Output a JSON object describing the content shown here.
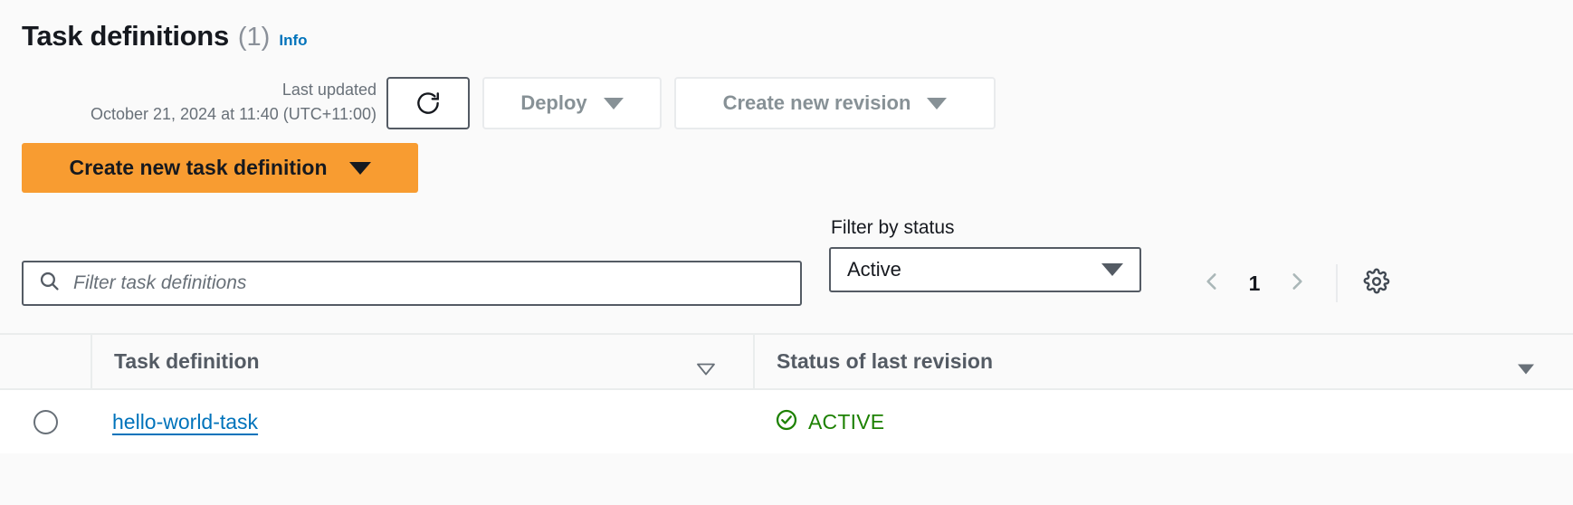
{
  "header": {
    "title": "Task definitions",
    "count": "(1)",
    "info_label": "Info"
  },
  "actions": {
    "last_updated_label": "Last updated",
    "last_updated_value": "October 21, 2024 at 11:40 (UTC+11:00)",
    "refresh_icon": "refresh-icon",
    "deploy_label": "Deploy",
    "create_revision_label": "Create new revision",
    "create_task_definition_label": "Create new task definition"
  },
  "filters": {
    "search_placeholder": "Filter task definitions",
    "search_value": "",
    "search_icon": "search-icon",
    "status_label": "Filter by status",
    "status_value": "Active",
    "status_options": [
      "Active"
    ]
  },
  "pagination": {
    "prev_icon": "chevron-left-icon",
    "page_number": "1",
    "next_icon": "chevron-right-icon",
    "settings_icon": "gear-icon"
  },
  "table": {
    "columns": [
      {
        "label": "Task definition",
        "sort_icon": "sort-triangle-icon"
      },
      {
        "label": "Status of last revision",
        "sort_icon": "sort-triangle-icon"
      }
    ],
    "rows": [
      {
        "task_definition": "hello-world-task",
        "status": "ACTIVE",
        "status_icon": "check-circle-icon"
      }
    ]
  },
  "colors": {
    "primary_orange": "#f89c31",
    "link_blue": "#0073bb",
    "status_green": "#1d8102",
    "text_dark": "#16191f",
    "text_muted": "#687078",
    "disabled_text": "#879196",
    "border_dark": "#545b64",
    "border_light": "#e9ebed",
    "page_bg": "#fafafa"
  }
}
